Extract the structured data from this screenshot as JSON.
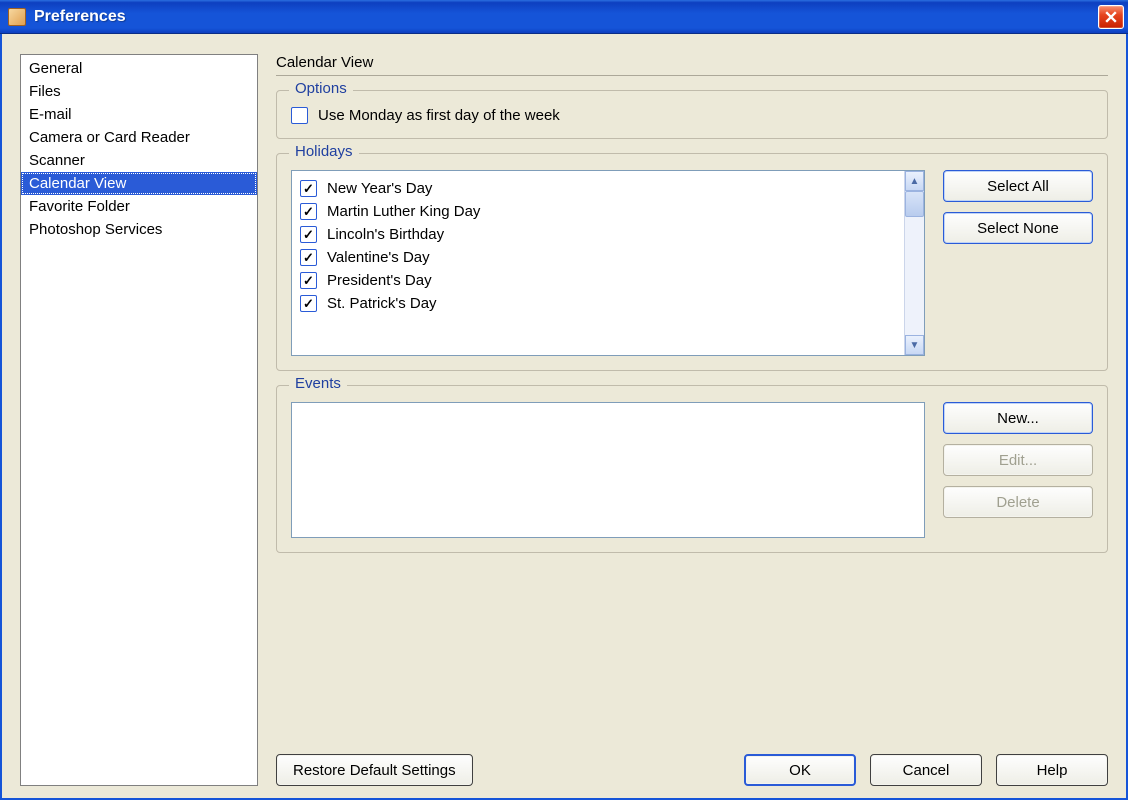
{
  "window": {
    "title": "Preferences"
  },
  "sidebar": {
    "items": [
      {
        "label": "General",
        "selected": false
      },
      {
        "label": "Files",
        "selected": false
      },
      {
        "label": "E-mail",
        "selected": false
      },
      {
        "label": "Camera or Card Reader",
        "selected": false
      },
      {
        "label": "Scanner",
        "selected": false
      },
      {
        "label": "Calendar View",
        "selected": true
      },
      {
        "label": "Favorite Folder",
        "selected": false
      },
      {
        "label": "Photoshop Services",
        "selected": false
      }
    ]
  },
  "main": {
    "section_title": "Calendar View",
    "options": {
      "legend": "Options",
      "monday_first": {
        "label": "Use Monday as first day of the week",
        "checked": false
      }
    },
    "holidays": {
      "legend": "Holidays",
      "items": [
        {
          "label": "New Year's Day",
          "checked": true
        },
        {
          "label": "Martin Luther King Day",
          "checked": true
        },
        {
          "label": "Lincoln's Birthday",
          "checked": true
        },
        {
          "label": "Valentine's Day",
          "checked": true
        },
        {
          "label": "President's Day",
          "checked": true
        },
        {
          "label": "St. Patrick's Day",
          "checked": true
        }
      ],
      "select_all": "Select All",
      "select_none": "Select None"
    },
    "events": {
      "legend": "Events",
      "new": "New...",
      "edit": "Edit...",
      "delete": "Delete"
    }
  },
  "footer": {
    "restore": "Restore Default Settings",
    "ok": "OK",
    "cancel": "Cancel",
    "help": "Help"
  }
}
